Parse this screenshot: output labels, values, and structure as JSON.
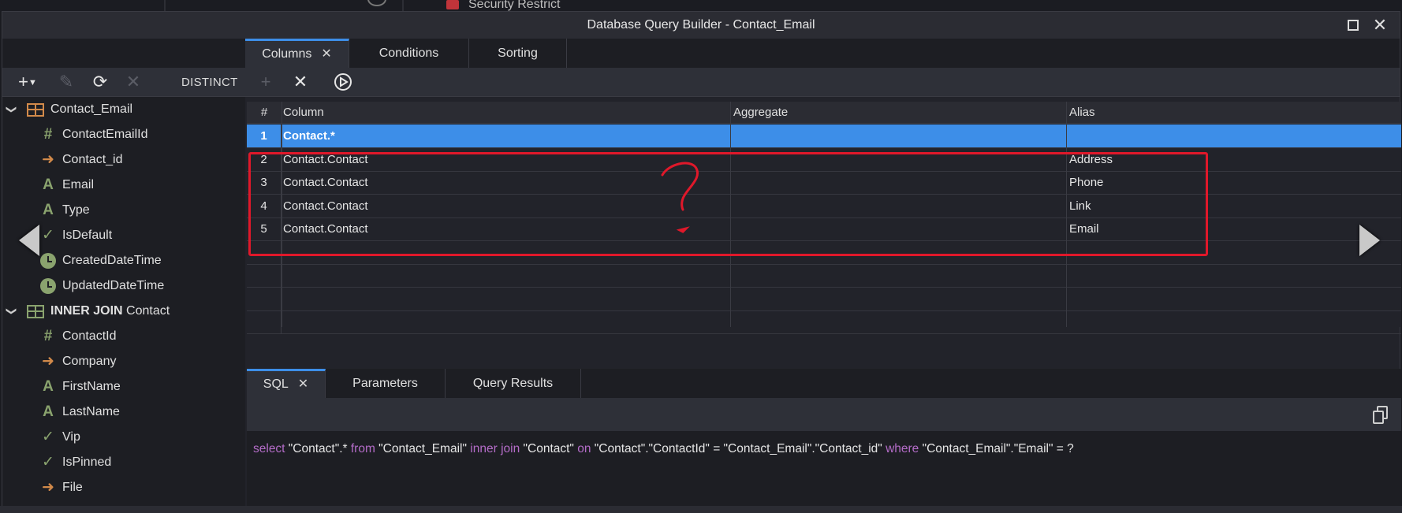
{
  "background": {
    "security_label": "Security Restrict"
  },
  "window": {
    "title": "Database Query Builder - Contact_Email"
  },
  "top_tabs": [
    {
      "label": "Columns",
      "active": true
    },
    {
      "label": "Conditions",
      "active": false
    },
    {
      "label": "Sorting",
      "active": false
    }
  ],
  "toolbar": {
    "add_icon": "plus-icon",
    "distinct_label": "DISTINCT"
  },
  "tree": {
    "table1": {
      "name": "Contact_Email",
      "fields": [
        {
          "icon": "hash",
          "name": "ContactEmailId"
        },
        {
          "icon": "arrow",
          "name": "Contact_id"
        },
        {
          "icon": "text",
          "name": "Email"
        },
        {
          "icon": "text",
          "name": "Type"
        },
        {
          "icon": "check",
          "name": "IsDefault"
        },
        {
          "icon": "clock",
          "name": "CreatedDateTime"
        },
        {
          "icon": "clock",
          "name": "UpdatedDateTime"
        }
      ]
    },
    "join": {
      "keyword": "INNER JOIN",
      "name": "Contact",
      "fields": [
        {
          "icon": "hash",
          "name": "ContactId"
        },
        {
          "icon": "arrow",
          "name": "Company"
        },
        {
          "icon": "text",
          "name": "FirstName"
        },
        {
          "icon": "text",
          "name": "LastName"
        },
        {
          "icon": "check",
          "name": "Vip"
        },
        {
          "icon": "check",
          "name": "IsPinned"
        },
        {
          "icon": "arrow",
          "name": "File"
        }
      ]
    }
  },
  "grid": {
    "headers": {
      "num": "#",
      "column": "Column",
      "aggregate": "Aggregate",
      "alias": "Alias"
    },
    "rows": [
      {
        "num": "1",
        "column": "Contact.*",
        "aggregate": "",
        "alias": ""
      },
      {
        "num": "2",
        "column": "Contact.Contact",
        "aggregate": "",
        "alias": "Address"
      },
      {
        "num": "3",
        "column": "Contact.Contact",
        "aggregate": "",
        "alias": "Phone"
      },
      {
        "num": "4",
        "column": "Contact.Contact",
        "aggregate": "",
        "alias": "Link"
      },
      {
        "num": "5",
        "column": "Contact.Contact",
        "aggregate": "",
        "alias": "Email"
      }
    ],
    "selected_row": 0,
    "annotation_color": "#e0182a"
  },
  "bottom_tabs": [
    {
      "label": "SQL",
      "active": true
    },
    {
      "label": "Parameters",
      "active": false
    },
    {
      "label": "Query Results",
      "active": false
    }
  ],
  "sql": {
    "parts": [
      {
        "t": "select",
        "kw": true
      },
      {
        "t": " \"Contact\".* ",
        "kw": false
      },
      {
        "t": "from",
        "kw": true
      },
      {
        "t": " \"Contact_Email\" ",
        "kw": false
      },
      {
        "t": "inner join",
        "kw": true
      },
      {
        "t": " \"Contact\" ",
        "kw": false
      },
      {
        "t": "on",
        "kw": true
      },
      {
        "t": " \"Contact\".\"ContactId\" = \"Contact_Email\".\"Contact_id\" ",
        "kw": false
      },
      {
        "t": "where",
        "kw": true
      },
      {
        "t": " \"Contact_Email\".\"Email\" = ?",
        "kw": false
      }
    ]
  },
  "colors": {
    "accent": "#3d8ee8",
    "keyword": "#b46cc8",
    "field_icon_green": "#8aa36e",
    "field_icon_orange": "#d28a4a"
  }
}
